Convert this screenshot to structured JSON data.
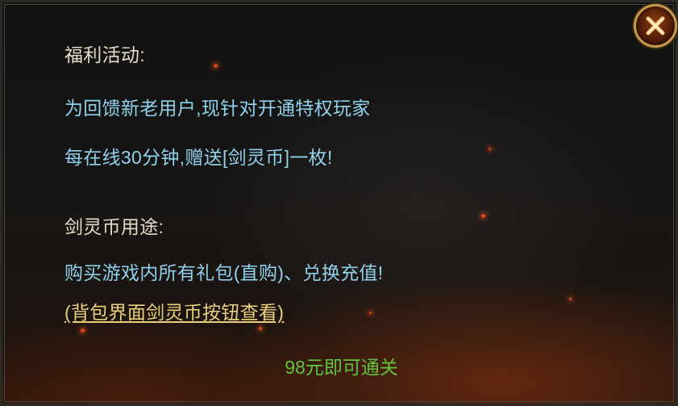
{
  "dialog": {
    "heading_event": "福利活动:",
    "event_line_1": "为回馈新老用户,现针对开通特权玩家",
    "event_line_2": "每在线30分钟,赠送[剑灵币]一枚!",
    "heading_usage": "剑灵币用途:",
    "usage_line_1": "购买游戏内所有礼包(直购)、兑换充值!",
    "usage_link": "(背包界面剑灵币按钮查看)",
    "footer_text": "98元即可通关",
    "close_icon": "close-x-icon"
  },
  "colors": {
    "heading": "#e6dcc8",
    "body_text": "#8fd1ea",
    "link_text": "#ead07a",
    "footer_text": "#62c33c",
    "close_button_ring": "#c79a4e",
    "close_button_fill": "#6a2a0c"
  }
}
